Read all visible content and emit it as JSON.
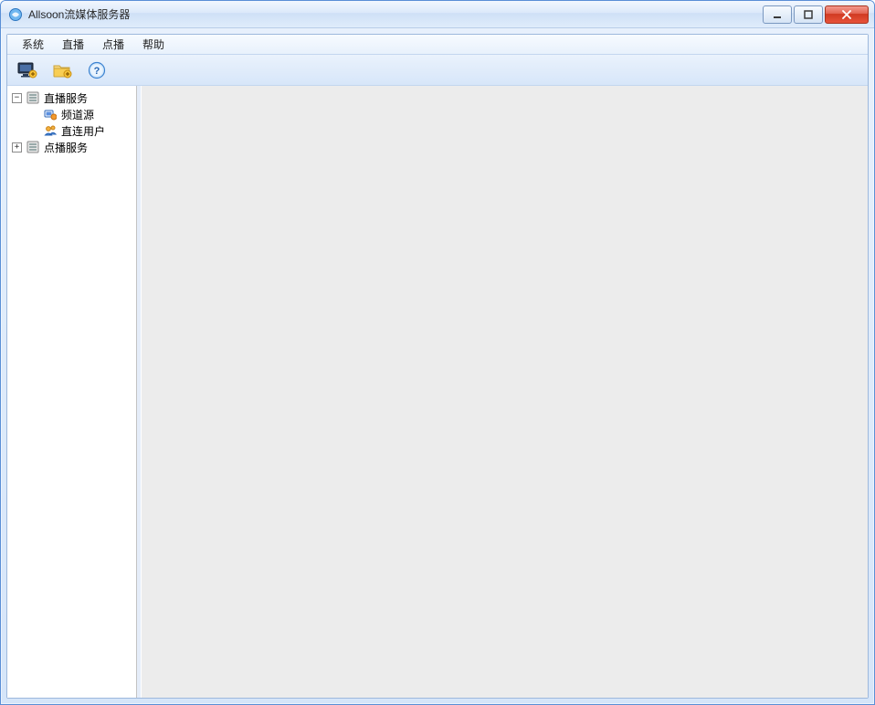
{
  "window": {
    "title": "Allsoon流媒体服务器"
  },
  "menu": {
    "items": [
      "系统",
      "直播",
      "点播",
      "帮助"
    ]
  },
  "toolbar": {
    "btn_monitor": "monitor",
    "btn_folder": "folder",
    "btn_help": "help"
  },
  "tree": {
    "nodes": [
      {
        "label": "直播服务",
        "expanded": true,
        "icon": "server"
      },
      {
        "label": "频道源",
        "child": true,
        "icon": "channel"
      },
      {
        "label": "直连用户",
        "child": true,
        "icon": "users"
      },
      {
        "label": "点播服务",
        "expanded": false,
        "icon": "server"
      }
    ]
  }
}
